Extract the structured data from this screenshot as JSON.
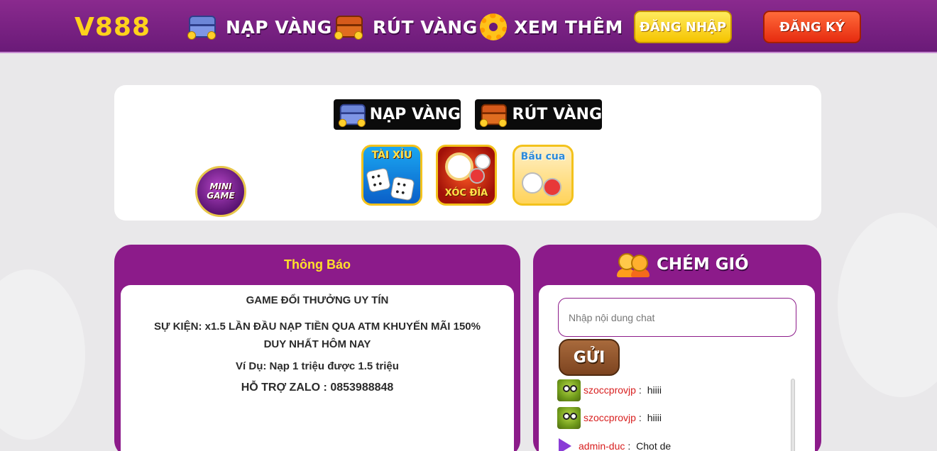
{
  "header": {
    "logo": "V888",
    "nav": [
      {
        "label": "NẠP VÀNG",
        "icon": "blue-treasure-chest-icon"
      },
      {
        "label": "RÚT VÀNG",
        "icon": "red-treasure-chest-icon"
      },
      {
        "label": "XEM THÊM",
        "icon": "gear-icon"
      }
    ],
    "login_label": "ĐĂNG NHẬP",
    "register_label": "ĐĂNG KÝ"
  },
  "game_panel": {
    "deposit_label": "NẠP VÀNG",
    "withdraw_label": "RÚT VÀNG",
    "mini_game_label": "MINI GAME",
    "games": [
      {
        "title": "TÀI XỈU"
      },
      {
        "title": "XÓC ĐĨA"
      },
      {
        "title": "Bầu cua"
      }
    ]
  },
  "notice": {
    "title": "Thông Báo",
    "lines": [
      "GAME ĐỔI THƯỞNG UY TÍN",
      "SỰ KIỆN: x1.5 LẦN ĐẦU NẠP TIỀN QUA ATM KHUYẾN MÃI 150% DUY NHẤT HÔM NAY",
      "Ví Dụ: Nạp 1 triệu được 1.5 triệu",
      "HỖ TRỢ ZALO : 0853988848"
    ]
  },
  "chat": {
    "title": "CHÉM GIÓ",
    "placeholder": "Nhập nội dung chat",
    "send_label": "GỬI",
    "messages": [
      {
        "user": "szoccprovjp",
        "text": "hiiii"
      },
      {
        "user": "szoccprovjp",
        "text": "hiiii"
      },
      {
        "user": "admin-duc",
        "text": "Chot de"
      }
    ]
  },
  "colors": {
    "header_purple": "#7a2184",
    "panel_purple": "#8c1b8a",
    "gold": "#ffd21c",
    "register_red": "#e62b10",
    "username_red": "#d81e1e"
  }
}
